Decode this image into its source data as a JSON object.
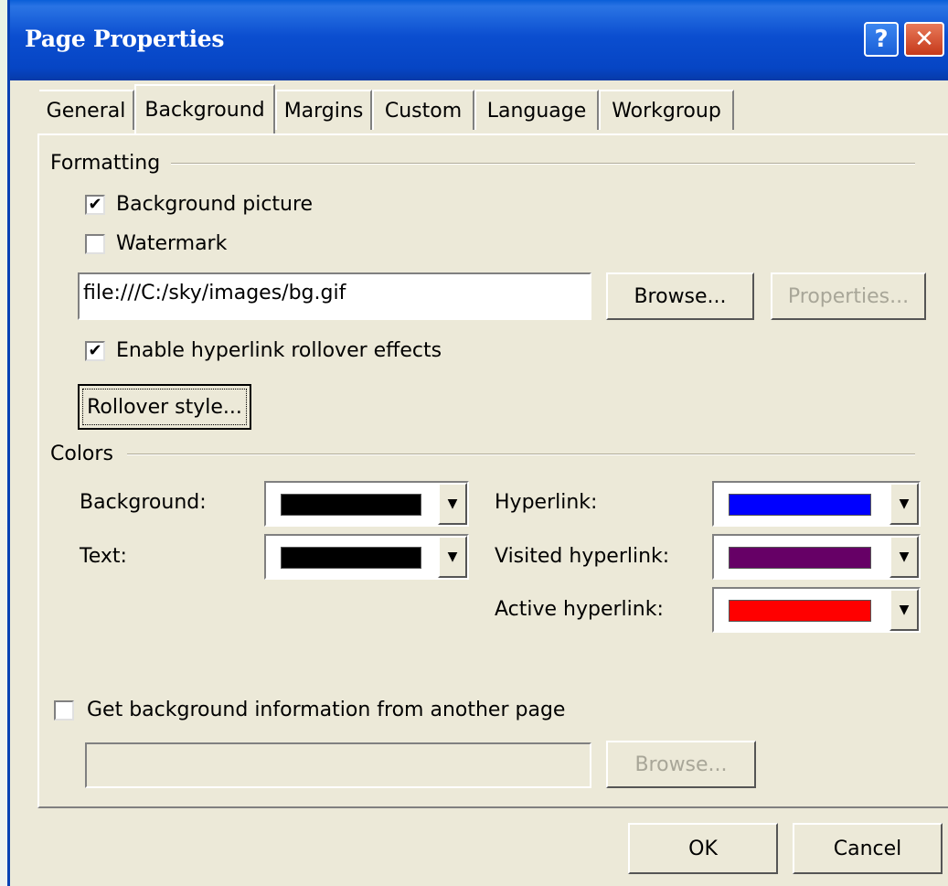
{
  "window": {
    "title": "Page Properties",
    "help_glyph": "?",
    "close_glyph": "✕"
  },
  "tabs": [
    "General",
    "Background",
    "Margins",
    "Custom",
    "Language",
    "Workgroup"
  ],
  "formatting": {
    "group_label": "Formatting",
    "background_picture": {
      "label": "Background picture",
      "checked": true
    },
    "watermark": {
      "label": "Watermark",
      "checked": false
    },
    "picture_path": "file:///C:/sky/images/bg.gif",
    "browse_label": "Browse...",
    "properties_label": "Properties...",
    "rollover": {
      "label": "Enable hyperlink rollover effects",
      "checked": true
    },
    "rollover_style_label": "Rollover style..."
  },
  "colors": {
    "group_label": "Colors",
    "background": {
      "label": "Background:",
      "color": "#000000"
    },
    "text": {
      "label": "Text:",
      "color": "#000000"
    },
    "hyperlink": {
      "label": "Hyperlink:",
      "color": "#0000ff"
    },
    "visited": {
      "label": "Visited hyperlink:",
      "color": "#660066"
    },
    "active": {
      "label": "Active hyperlink:",
      "color": "#ff0000"
    }
  },
  "other_page": {
    "label": "Get background information from another page",
    "checked": false,
    "path": "",
    "browse_label": "Browse..."
  },
  "footer": {
    "ok_label": "OK",
    "cancel_label": "Cancel"
  },
  "check_glyph": "✔",
  "dropdown_glyph": "▼"
}
